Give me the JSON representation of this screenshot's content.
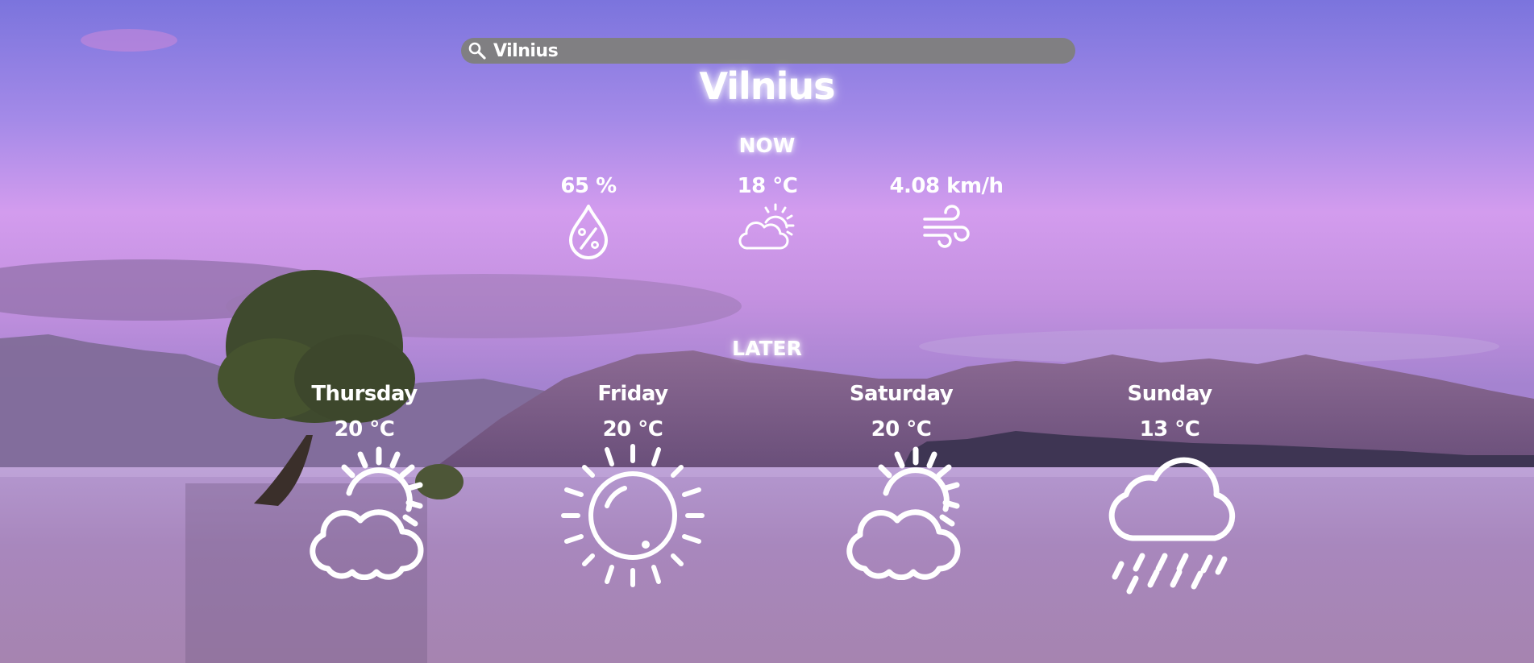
{
  "search": {
    "value": "Vilnius",
    "icon": "search-icon"
  },
  "city": "Vilnius",
  "now": {
    "title": "NOW",
    "humidity": {
      "value": "65 %",
      "icon": "humidity-drop-icon"
    },
    "temperature": {
      "value": "18 °C",
      "icon": "partly-cloudy-icon"
    },
    "wind": {
      "value": "4.08 km/h",
      "icon": "wind-icon"
    }
  },
  "later": {
    "title": "LATER",
    "days": [
      {
        "name": "Thursday",
        "temp": "20 °C",
        "icon": "partly-cloudy-icon"
      },
      {
        "name": "Friday",
        "temp": "20 °C",
        "icon": "sun-icon"
      },
      {
        "name": "Saturday",
        "temp": "20 °C",
        "icon": "partly-cloudy-icon"
      },
      {
        "name": "Sunday",
        "temp": "13 °C",
        "icon": "rain-cloud-icon"
      }
    ]
  },
  "colors": {
    "sky_top": "#7b76df",
    "sky_mid": "#c99bea",
    "water": "#a27fb4",
    "search_bg": "#808080"
  }
}
